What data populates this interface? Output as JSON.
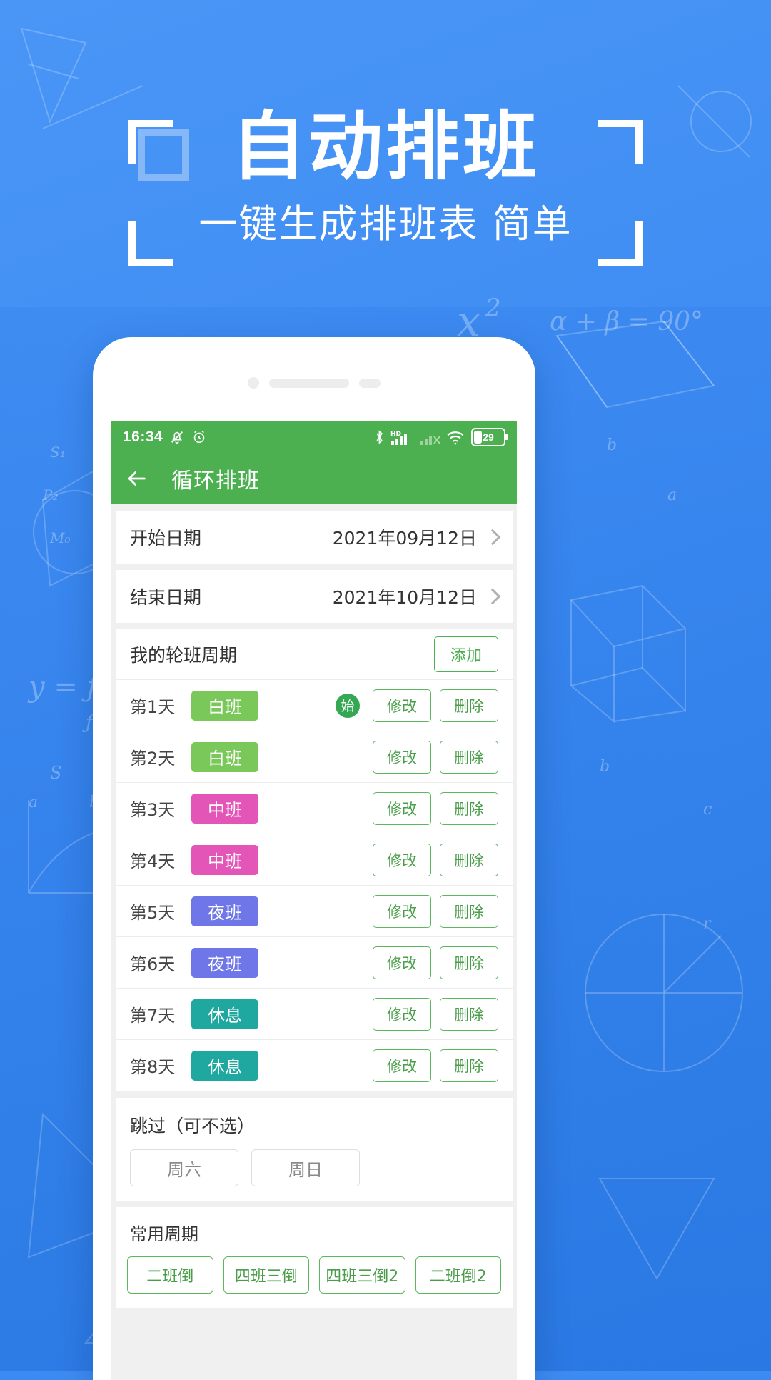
{
  "hero": {
    "title": "自动排班",
    "subtitle": "一键生成排班表 简单",
    "accent_blue": "#3d8bf2",
    "text_color": "#ffffff"
  },
  "phone": {
    "statusbar": {
      "time": "16:34",
      "icons": [
        "mute-icon",
        "alarm-icon",
        "bluetooth-icon",
        "hd-signal-icon",
        "signal-x-icon",
        "wifi-icon",
        "battery-icon"
      ],
      "battery_level": "29"
    },
    "appbar": {
      "back": "back-arrow-icon",
      "title": "循环排班",
      "bg_color": "#4caf50"
    },
    "fields": [
      {
        "label": "开始日期",
        "value": "2021年09月12日"
      },
      {
        "label": "结束日期",
        "value": "2021年10月12日"
      }
    ],
    "cycle": {
      "title": "我的轮班周期",
      "add_label": "添加",
      "start_marker": "始",
      "edit_label": "修改",
      "delete_label": "删除",
      "days": [
        {
          "day": "第1天",
          "shift": "白班",
          "color": "#7bc85a",
          "start": true
        },
        {
          "day": "第2天",
          "shift": "白班",
          "color": "#7bc85a",
          "start": false
        },
        {
          "day": "第3天",
          "shift": "中班",
          "color": "#e455b8",
          "start": false
        },
        {
          "day": "第4天",
          "shift": "中班",
          "color": "#e455b8",
          "start": false
        },
        {
          "day": "第5天",
          "shift": "夜班",
          "color": "#6f76e8",
          "start": false
        },
        {
          "day": "第6天",
          "shift": "夜班",
          "color": "#6f76e8",
          "start": false
        },
        {
          "day": "第7天",
          "shift": "休息",
          "color": "#1fa8a0",
          "start": false
        },
        {
          "day": "第8天",
          "shift": "休息",
          "color": "#1fa8a0",
          "start": false
        }
      ]
    },
    "skip": {
      "title": "跳过（可不选）",
      "options": [
        "周六",
        "周日"
      ]
    },
    "common": {
      "title": "常用周期",
      "options": [
        "二班倒",
        "四班三倒",
        "四班三倒2",
        "二班倒2"
      ]
    }
  }
}
